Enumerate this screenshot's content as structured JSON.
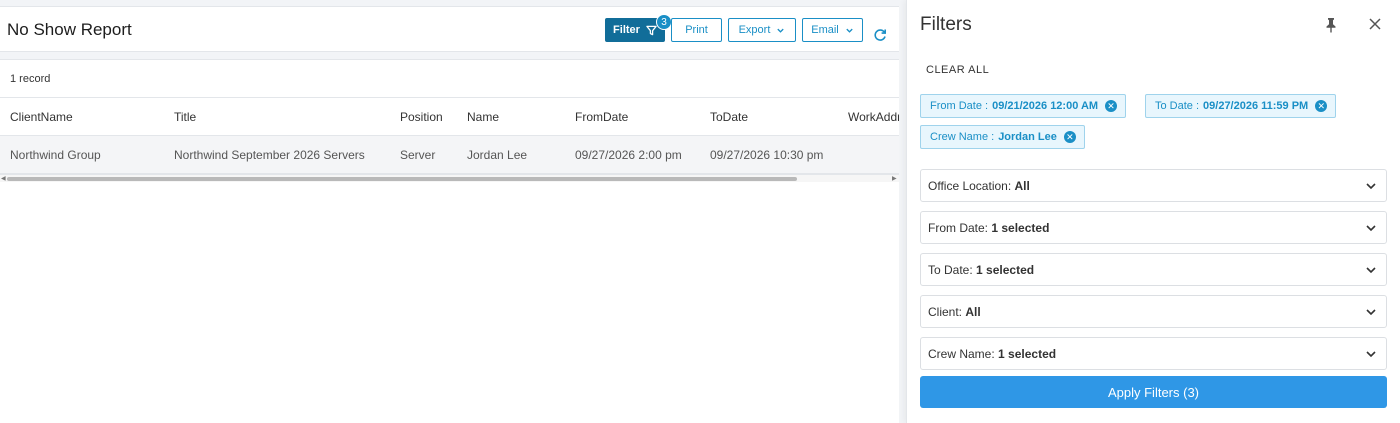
{
  "report": {
    "title": "No Show Report",
    "toolbar": {
      "filter_label": "Filter",
      "filter_badge": "3",
      "print_label": "Print",
      "export_label": "Export",
      "email_label": "Email"
    },
    "record_count": "1 record",
    "columns": [
      "ClientName",
      "Title",
      "Position",
      "Name",
      "FromDate",
      "ToDate",
      "WorkAddr"
    ],
    "rows": [
      [
        "Northwind Group",
        "Northwind September 2026 Servers",
        "Server",
        "Jordan Lee",
        "09/27/2026 2:00 pm",
        "09/27/2026 10:30 pm",
        ""
      ]
    ]
  },
  "filters": {
    "title": "Filters",
    "clear_all": "CLEAR ALL",
    "chips": [
      {
        "label": "From Date :",
        "value": "09/21/2026 12:00 AM"
      },
      {
        "label": "To Date :",
        "value": "09/27/2026 11:59 PM"
      },
      {
        "label": "Crew Name :",
        "value": "Jordan Lee"
      }
    ],
    "dropdowns": [
      {
        "label": "Office Location:",
        "value": "All"
      },
      {
        "label": "From Date:",
        "value": "1 selected"
      },
      {
        "label": "To Date:",
        "value": "1 selected"
      },
      {
        "label": "Client:",
        "value": "All"
      },
      {
        "label": "Crew Name:",
        "value": "1 selected"
      }
    ],
    "apply_label": "Apply Filters (3)"
  },
  "colors": {
    "accent": "#1a8fc6",
    "filter_button": "#116d99",
    "apply_button": "#2f97e6"
  }
}
